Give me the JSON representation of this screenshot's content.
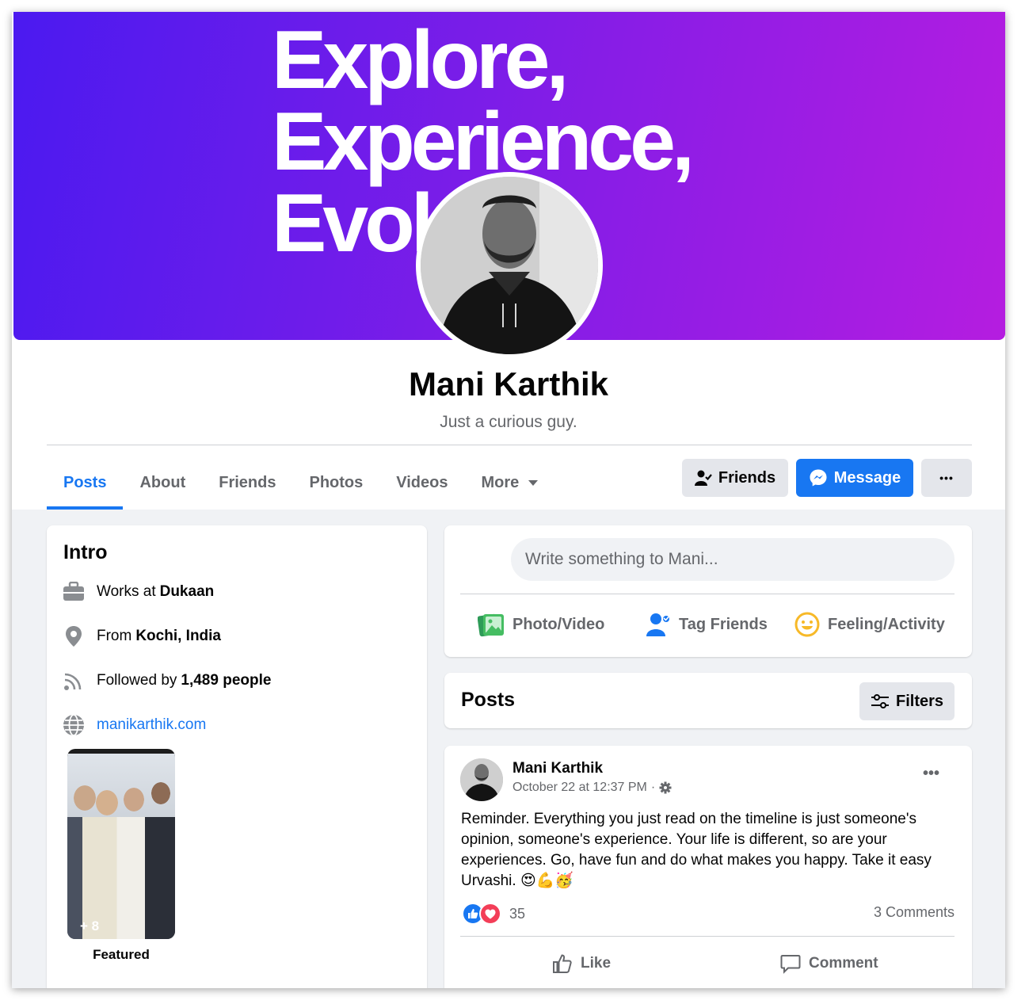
{
  "cover": {
    "line1": "Explore,",
    "line2": "Experience,",
    "line3": "Evol"
  },
  "profile": {
    "name": "Mani Karthik",
    "bio": "Just a curious guy."
  },
  "tabs": [
    {
      "label": "Posts",
      "active": true
    },
    {
      "label": "About"
    },
    {
      "label": "Friends"
    },
    {
      "label": "Photos"
    },
    {
      "label": "Videos"
    },
    {
      "label": "More"
    }
  ],
  "actions": {
    "friends_label": "Friends",
    "message_label": "Message",
    "more_label": "•••"
  },
  "intro": {
    "title": "Intro",
    "work_prefix": "Works at",
    "work_place": "Dukaan",
    "from_prefix": "From",
    "from_place": "Kochi, India",
    "followers_prefix": "Followed by",
    "followers": "1,489 people",
    "website": "manikarthik.com",
    "featured_more": "+ 8",
    "featured_label": "Featured"
  },
  "composer": {
    "placeholder": "Write something to Mani...",
    "photo_label": "Photo/Video",
    "tag_label": "Tag Friends",
    "feeling_label": "Feeling/Activity"
  },
  "posts_section": {
    "title": "Posts",
    "filters_label": "Filters"
  },
  "post": {
    "author": "Mani Karthik",
    "time": "October 22 at 12:37 PM",
    "separator": "·",
    "more": "•••",
    "text": "Reminder. Everything you just read on the timeline is just someone's opinion, someone's experience. Your life is different, so are your experiences. Go, have fun and do what makes you happy. Take it easy Urvashi. 😍💪🥳",
    "reaction_count": "35",
    "comments": "3 Comments",
    "like_label": "Like",
    "comment_label": "Comment"
  },
  "colors": {
    "accent": "#1877f2",
    "cover_start": "#4b1af0",
    "cover_end": "#b51de0"
  }
}
